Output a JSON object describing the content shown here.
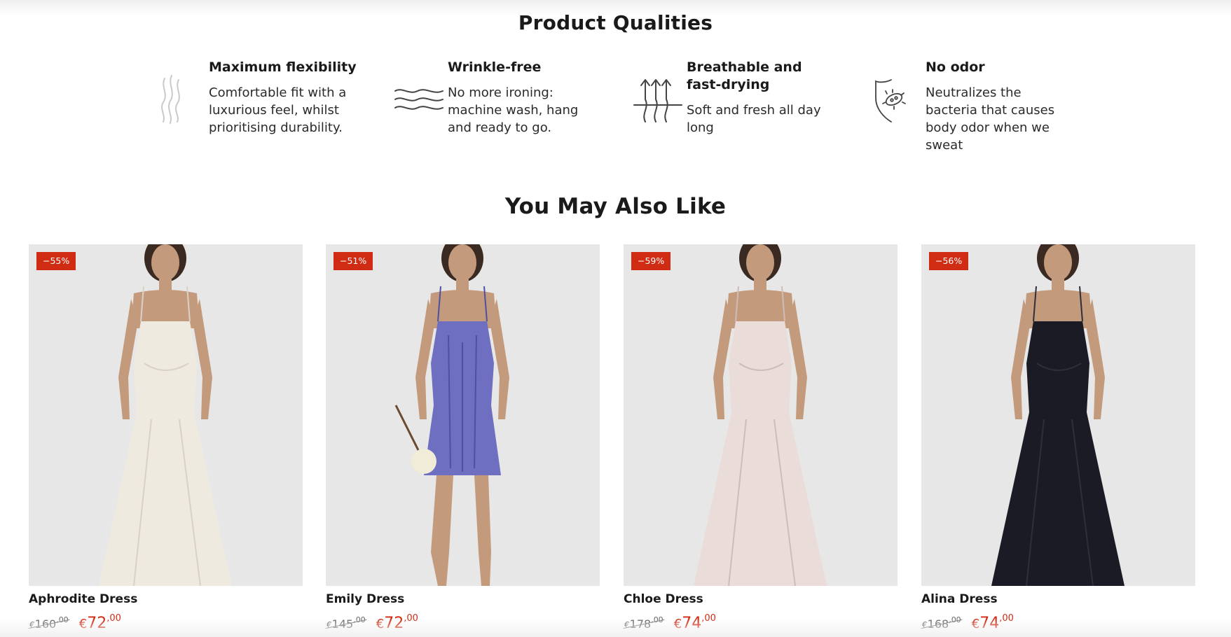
{
  "qualities": {
    "title": "Product Qualities",
    "items": [
      {
        "icon": "flexibility-waves-icon",
        "title": "Maximum flexibility",
        "text": "Comfortable fit with a luxurious feel, whilst prioritising durability."
      },
      {
        "icon": "wrinkle-free-icon",
        "title": "Wrinkle-free",
        "text": "No more ironing: machine wash, hang and ready to go."
      },
      {
        "icon": "breathable-arrows-icon",
        "title": "Breathable and fast-drying",
        "text": "Soft and fresh all day long"
      },
      {
        "icon": "no-odor-shield-icon",
        "title": "No odor",
        "text": "Neutralizes the bacteria that causes body odor when we sweat"
      }
    ]
  },
  "related": {
    "title": "You May Also Like",
    "products": [
      {
        "name": "Aphrodite Dress",
        "badge": "−55%",
        "currency": "€",
        "old_int": "160",
        "old_dec": "00",
        "new_int": "72",
        "new_dec": "00",
        "dress_color": "#eeeae0",
        "dress_shade": "#d8d2c6",
        "dress_length": "long"
      },
      {
        "name": "Emily Dress",
        "badge": "−51%",
        "currency": "€",
        "old_int": "145",
        "old_dec": "00",
        "new_int": "72",
        "new_dec": "00",
        "dress_color": "#6e6fc0",
        "dress_shade": "#4e50a0",
        "dress_length": "mini"
      },
      {
        "name": "Chloe Dress",
        "badge": "−59%",
        "currency": "€",
        "old_int": "178",
        "old_dec": "00",
        "new_int": "74",
        "new_dec": "00",
        "dress_color": "#eadcd8",
        "dress_shade": "#cdbcb8",
        "dress_length": "long"
      },
      {
        "name": "Alina Dress",
        "badge": "−56%",
        "currency": "€",
        "old_int": "168",
        "old_dec": "00",
        "new_int": "74",
        "new_dec": "00",
        "dress_color": "#1b1b26",
        "dress_shade": "#2e2e3c",
        "dress_length": "long"
      }
    ]
  },
  "colors": {
    "sale_red": "#d02b13",
    "text": "#1a1a1a",
    "image_bg": "#e6e6e6"
  }
}
